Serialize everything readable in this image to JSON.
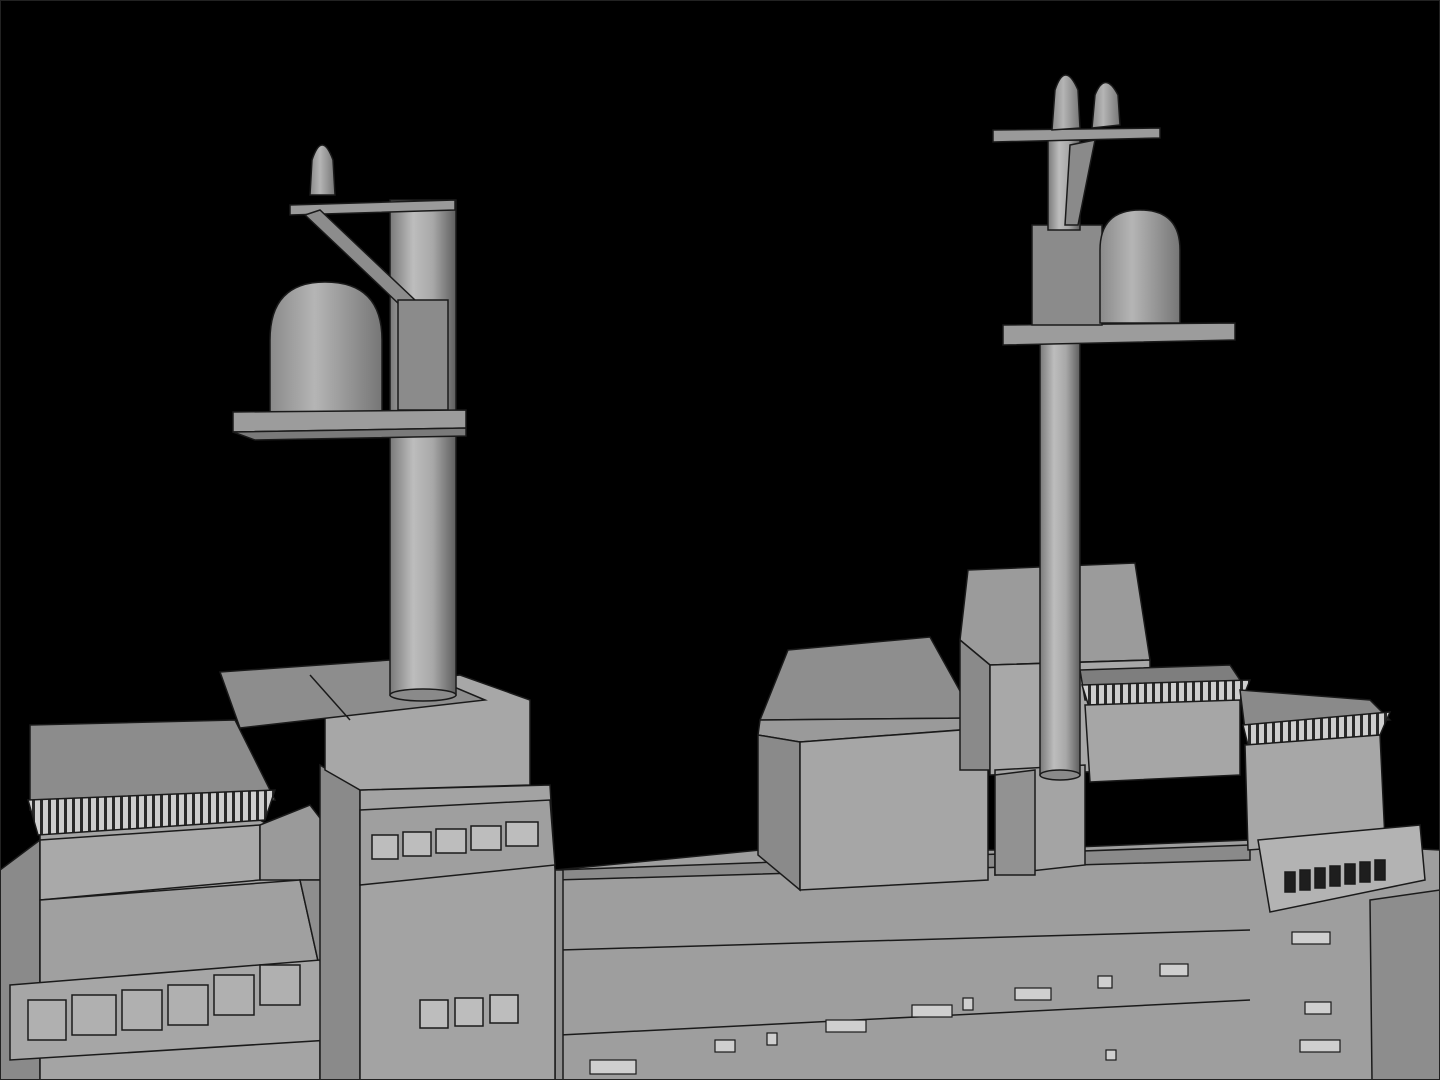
{
  "colors": {
    "background": "#000000",
    "hull_light": "#a9a9a9",
    "hull_mid": "#9c9c9c",
    "hull_dark": "#6e6e6e",
    "deck": "#858585",
    "outline": "#1a1a1a",
    "window": "#4a4a4a"
  },
  "masts": [
    {
      "name": "fore-mast",
      "radome": "dome",
      "whip_antennas": 1
    },
    {
      "name": "main-mast",
      "radome": "dome",
      "whip_antennas": 2
    }
  ]
}
